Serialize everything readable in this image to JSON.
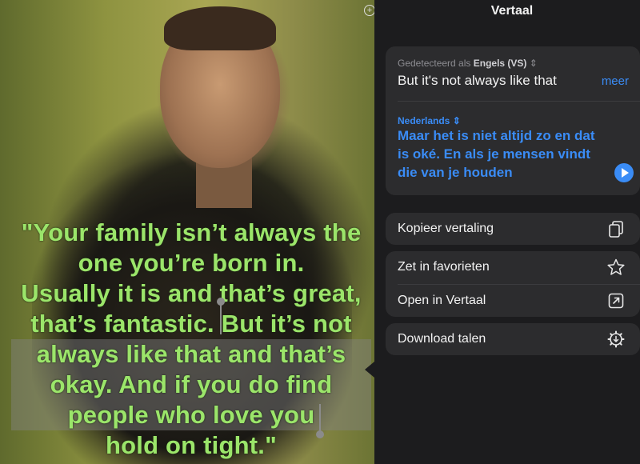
{
  "image": {
    "quote": [
      "\"Your family isn’t always the",
      "one you’re born in.",
      "Usually it is and that’s great,",
      "that’s fantastic. But it’s not",
      "always like that and that’s",
      "okay. And if you do find",
      "people who love you",
      "hold on tight.\""
    ]
  },
  "panel": {
    "title": "Vertaal",
    "detected_prefix": "Gedetecteerd als",
    "detected_lang": "Engels (VS)",
    "source_text": "But it's not always like that",
    "more_label": "meer",
    "target_lang": "Nederlands",
    "target_text": "Maar het is niet altijd zo en dat is oké. En als je mensen vindt die van je houden",
    "actions": [
      {
        "label": "Kopieer vertaling",
        "icon": "copy-icon"
      },
      {
        "label": "Zet in favorieten",
        "icon": "star-icon"
      },
      {
        "label": "Open in Vertaal",
        "icon": "open-external-icon"
      },
      {
        "label": "Download talen",
        "icon": "gear-download-icon"
      }
    ]
  },
  "colors": {
    "accent": "#3a8cf6",
    "quote_text": "#9be56a",
    "panel_bg": "#1c1c1e",
    "card_bg": "#2c2c2e"
  }
}
